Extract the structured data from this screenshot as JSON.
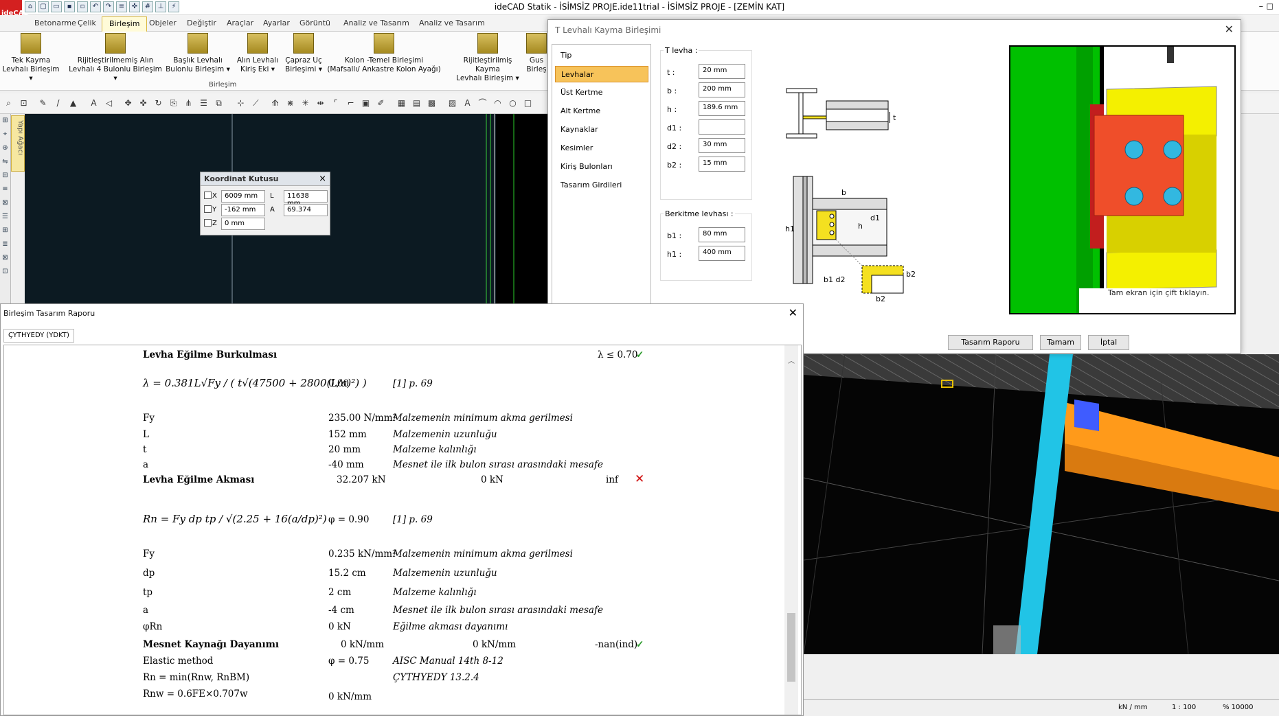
{
  "app": {
    "logo": "ideCAD",
    "title": "ideCAD Statik - İSİMSİZ PROJE.ide11trial - İSİMSİZ PROJE - [ZEMİN KAT]",
    "win_controls": "–   ◻"
  },
  "menu": [
    "Betonarme",
    "Çelik",
    "Birleşim",
    "Objeler",
    "Değiştir",
    "Araçlar",
    "Ayarlar",
    "Görüntü",
    "Analiz ve Tasarım",
    "Analiz ve Tasarım"
  ],
  "menu_active_index": 2,
  "ribbon": {
    "buttons": [
      {
        "l1": "Tek Kayma",
        "l2": "Levhalı Birleşim ▾"
      },
      {
        "l1": "Rijitleştirilmemiş Alın",
        "l2": "Levhalı 4 Bulonlu Birleşim ▾"
      },
      {
        "l1": "Başlık Levhalı",
        "l2": "Bulonlu Birleşim ▾"
      },
      {
        "l1": "Alın Levhalı",
        "l2": "Kiriş Eki ▾"
      },
      {
        "l1": "Çapraz Uç",
        "l2": "Birleşimi ▾"
      },
      {
        "l1": "Kolon -Temel Birleşimi",
        "l2": "(Mafsallı/ Ankastre Kolon Ayağı)"
      },
      {
        "l1": "Rijitleştirilmiş Kayma",
        "l2": "Levhalı Birleşim ▾"
      },
      {
        "l1": "Gus",
        "l2": "Birleş"
      }
    ],
    "group_label": "Birleşim"
  },
  "left_panel_tab": "Yapı Ağacı",
  "coord_box": {
    "title": "Koordinat Kutusu",
    "x_label": "X",
    "x": "6009 mm",
    "y_label": "Y",
    "y": "-162 mm",
    "z_label": "Z",
    "z": "0 mm",
    "l_label": "L",
    "l": "11638 mm",
    "a_label": "A",
    "a": "69.374"
  },
  "dialog": {
    "title": "T Levhalı Kayma Birleşimi",
    "nav": [
      "Tip",
      "Levhalar",
      "Üst Kertme",
      "Alt Kertme",
      "Kaynaklar",
      "Kesimler",
      "Kiriş Bulonları",
      "Tasarım Girdileri"
    ],
    "nav_active_index": 1,
    "t_group": "T levha :",
    "params": [
      {
        "label": "t :",
        "value": "20 mm"
      },
      {
        "label": "b :",
        "value": "200 mm"
      },
      {
        "label": "h :",
        "value": "189.6 mm"
      },
      {
        "label": "d1 :",
        "value": ""
      },
      {
        "label": "d2 :",
        "value": "30 mm"
      },
      {
        "label": "b2 :",
        "value": "15 mm"
      }
    ],
    "stiff_group": "Berkitme levhası :",
    "stiff_params": [
      {
        "label": "b1 :",
        "value": "80 mm"
      },
      {
        "label": "h1 :",
        "value": "400 mm"
      }
    ],
    "fullscreen_hint": "Tam ekran için çift tıklayın.",
    "buttons": {
      "report": "Tasarım Raporu",
      "ok": "Tamam",
      "cancel": "İptal"
    },
    "sketch_labels": {
      "t": "t",
      "b": "b",
      "h": "h",
      "h1": "h1",
      "d1": "d1",
      "b1d2": "b1 d2",
      "b2a": "b2",
      "b2b": "b2"
    }
  },
  "report": {
    "title": "Birleşim Tasarım Raporu",
    "tab": "ÇYTHYEDY (YDKT)",
    "rows": [
      {
        "c1": "Levha Eğilme Burkulması",
        "bold": true,
        "c4": "λ ≤ 0.70",
        "check": "✓"
      },
      {
        "c1": "λ = 0.381L√Fy / ( t√(47500 + 2800(L/a)²) )",
        "formula": true,
        "c2": "0.00",
        "c3": "[1] p. 69"
      },
      {
        "c1": "Fy",
        "c2": "235.00 N/mm²",
        "c3": "Malzemenin minimum akma gerilmesi"
      },
      {
        "c1": "L",
        "c2": "152 mm",
        "c3": "Malzemenin uzunluğu"
      },
      {
        "c1": "t",
        "c2": "20 mm",
        "c3": "Malzeme kalınlığı"
      },
      {
        "c1": "a",
        "c2": "-40 mm",
        "c3": "Mesnet ile ilk bulon sırası arasındaki mesafe"
      },
      {
        "c1": "Levha Eğilme Akması",
        "bold": true,
        "c2": "32.207 kN",
        "c2b": "0 kN",
        "c4": "inf",
        "cross": "✕"
      },
      {
        "c1": "Rn = Fy dp tp / √(2.25 + 16(a/dp)²)",
        "formula": true,
        "c2": "φ = 0.90",
        "c3": "[1] p. 69"
      },
      {
        "c1": "Fy",
        "c2": "0.235 kN/mm²",
        "c3": "Malzemenin minimum akma gerilmesi"
      },
      {
        "c1": "dp",
        "c2": "15.2 cm",
        "c3": "Malzemenin uzunluğu"
      },
      {
        "c1": "tp",
        "c2": "2 cm",
        "c3": "Malzeme kalınlığı"
      },
      {
        "c1": "a",
        "c2": "-4 cm",
        "c3": "Mesnet ile ilk bulon sırası arasındaki mesafe"
      },
      {
        "c1": "φRn",
        "c2": "0 kN",
        "c3": "Eğilme akması dayanımı"
      },
      {
        "c1": "Mesnet Kaynağı Dayanımı",
        "bold": true,
        "c2": "0 kN/mm",
        "c2b": "0 kN/mm",
        "c4": "-nan(ind)",
        "check": "✓"
      },
      {
        "c1": "Elastic method",
        "c2": "φ = 0.75",
        "c3": "AISC Manual 14th 8-12"
      },
      {
        "c1": "Rn = min(Rnw, RnBM)",
        "c3": "ÇYTHYEDY 13.2.4"
      },
      {
        "c1": "Rnw = 0.6FE×0.707w",
        "c2": "0 kN/mm"
      }
    ]
  },
  "status": {
    "units": "kN / mm",
    "scale": "1 : 100",
    "zoom": "% 10000"
  },
  "colors": {
    "accent": "#f7c35a",
    "check": "#2a9a2a",
    "cross": "#d01010",
    "model_green": "#00c000",
    "model_yellow": "#f4f000",
    "model_red": "#ef4e2a",
    "beam_cyan": "#20c8e8",
    "beam_orange": "#ffa020"
  }
}
